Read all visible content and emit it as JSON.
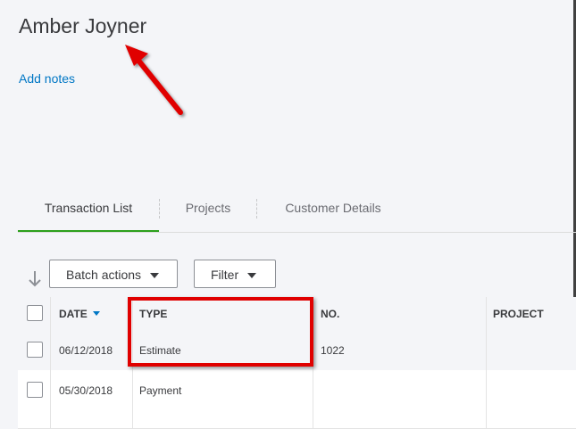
{
  "customer": {
    "name": "Amber Joyner",
    "add_notes": "Add notes"
  },
  "tabs": [
    {
      "label": "Transaction List",
      "active": true
    },
    {
      "label": "Projects",
      "active": false
    },
    {
      "label": "Customer Details",
      "active": false
    }
  ],
  "toolbar": {
    "batch_actions": "Batch actions",
    "filter": "Filter"
  },
  "table": {
    "headers": {
      "date": "DATE",
      "type": "TYPE",
      "no": "NO.",
      "project": "PROJECT"
    },
    "rows": [
      {
        "date": "06/12/2018",
        "type": "Estimate",
        "no": "1022",
        "project": ""
      },
      {
        "date": "05/30/2018",
        "type": "Payment",
        "no": "",
        "project": ""
      }
    ]
  },
  "colors": {
    "accent_green": "#2ca01c",
    "link_blue": "#0077c5",
    "annotation_red": "#e00000"
  }
}
